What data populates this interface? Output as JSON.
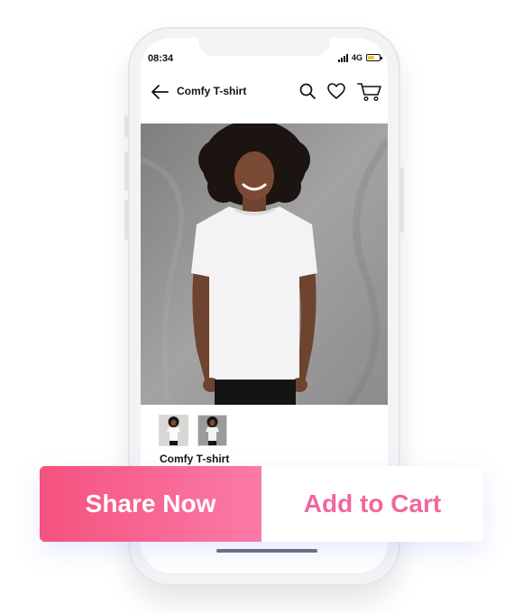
{
  "status_bar": {
    "time": "08:34",
    "network": "4G",
    "battery_color": "#f2c12e"
  },
  "header": {
    "title": "Comfy T-shirt",
    "icons": [
      "back-arrow-icon",
      "search-icon",
      "heart-icon",
      "cart-icon"
    ]
  },
  "product": {
    "name": "Comfy T-shirt"
  },
  "actions": {
    "share_label": "Share Now",
    "cart_label": "Add to Cart"
  },
  "colors": {
    "accent": "#f5527f",
    "accent_light": "#fb7aa7",
    "cart_text": "#f0679b"
  }
}
